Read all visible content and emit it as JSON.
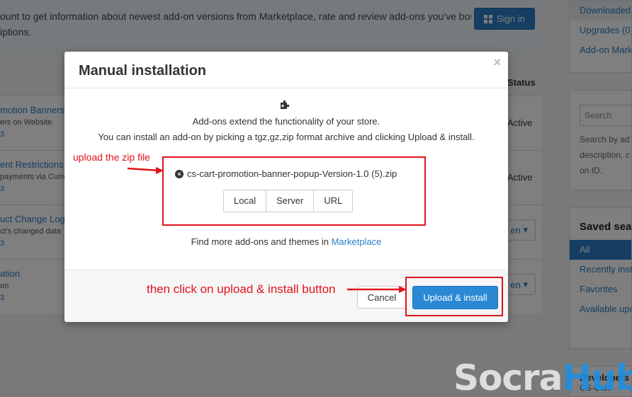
{
  "background": {
    "notice": {
      "line1": "ount to get information about newest add-on versions from Marketplace, rate and review add-ons you've bought,",
      "line2": "iptions.",
      "sign_in_label": "Sign in"
    },
    "status_header": "Status",
    "rows": [
      {
        "title": "motion Banners a",
        "desc": "ers on Website.",
        "meta": "3",
        "status": "Active"
      },
      {
        "title": "ent Restrictions",
        "desc": "payments via Curre",
        "meta": "3",
        "status": "Active"
      },
      {
        "title": "uct Change Log",
        "desc": "ct's changed data",
        "meta": "3",
        "dropdown": "en"
      },
      {
        "title": "ation",
        "desc": "on",
        "meta": "3",
        "dropdown": "en"
      }
    ],
    "sidebar": {
      "top_links": [
        "Downloaded",
        "Upgrades (0)",
        "Add-on Mark"
      ],
      "search_placeholder": "Search",
      "search_help": [
        "Search by ad",
        "description, c",
        "on ID."
      ],
      "saved_heading": "Saved sea",
      "saved_links": [
        "All",
        "Recently inst",
        "Favorites",
        "Available upd"
      ],
      "developers_heading": "Developers",
      "developers_sub": "CS-Cart"
    }
  },
  "modal": {
    "title": "Manual installation",
    "close_glyph": "×",
    "intro_line1": "Add-ons extend the functionality of your store.",
    "intro_line2": "You can install an add-on by picking a tgz,gz,zip format archive and clicking Upload & install.",
    "file_name": "cs-cart-promotion-banner-popup-Version-1.0 (5).zip",
    "remove_glyph": "×",
    "sources": [
      "Local",
      "Server",
      "URL"
    ],
    "find_more_text": "Find more add-ons and themes in",
    "marketplace_link": "Marketplace",
    "cancel_label": "Cancel",
    "upload_label": "Upload & install"
  },
  "annotations": {
    "zip_hint": "upload the zip file",
    "button_hint": "then click on upload & install button",
    "color": "#e0141b"
  },
  "watermark": {
    "part1": "Socra",
    "part2": "Hub"
  },
  "colors": {
    "accent": "#2a88d4",
    "link": "#2a7dc5",
    "annotation": "#e0141b"
  }
}
